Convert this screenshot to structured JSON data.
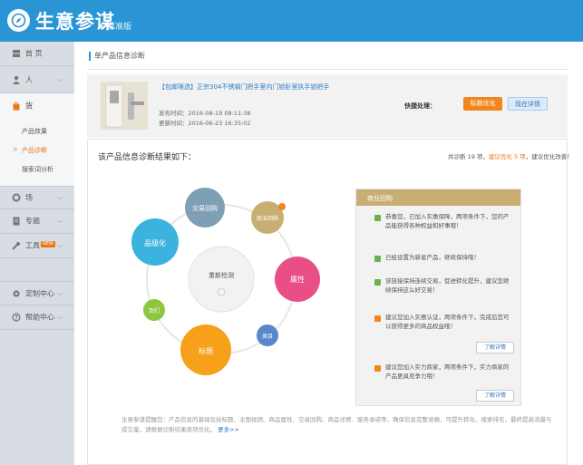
{
  "header": {
    "brand": "生意参谋",
    "edition": "标准版"
  },
  "sidebar": {
    "items": [
      {
        "label": "首 页",
        "icon": "home-icon",
        "chevron": ""
      },
      {
        "label": "人",
        "icon": "user-icon",
        "chevron": "⌵"
      },
      {
        "label": "货",
        "icon": "bag-icon",
        "chevron": ""
      },
      {
        "label": "场",
        "icon": "gear-icon",
        "chevron": "⌵"
      },
      {
        "label": "专题",
        "icon": "file-icon",
        "chevron": "⌵"
      },
      {
        "label": "工具",
        "icon": "wrench-icon",
        "chevron": "⌵",
        "badge": "NEW"
      },
      {
        "label": "定制中心",
        "icon": "settings-icon",
        "chevron": "⌵"
      },
      {
        "label": "帮助中心",
        "icon": "help-icon",
        "chevron": "⌵"
      }
    ],
    "sub_items": [
      "产品效果",
      "产品诊断",
      "搜索词分析"
    ]
  },
  "breadcrumb": "单产品信息诊断",
  "product": {
    "title": "【包邮限选】正宗304不锈钢门把手室内门锁卧室执手锁把手",
    "publish_label": "发布时间：",
    "publish_time": "2016-08-19 08:11:38",
    "update_label": "更新时间：",
    "update_time": "2016-06-23 16:35:02",
    "optimize_label": "快捷处理：",
    "btn_optimize": "标题优化",
    "btn_detail": "现在详情"
  },
  "result": {
    "title": "该产品信息诊断结果如下：",
    "summary_pre": "共诊断 19 项，",
    "summary_highlight": "建议优化 5 项",
    "summary_post": "，建议优化改善！"
  },
  "diagram": {
    "center": "重新检测",
    "bubbles": [
      "交易回购",
      "商业回购",
      "品级化",
      "属性",
      "到们",
      "标题",
      "类目"
    ]
  },
  "business": {
    "title": "商业回购",
    "items": [
      {
        "status": "ok",
        "text": "恭喜您，已加入实惠保障，两项条件下，您的产品能获得各种权益和好事哦！"
      },
      {
        "status": "ok",
        "text": "已经设置为新星产品，继续保持哦！"
      },
      {
        "status": "ok",
        "text": "该链接保持连续交易，促进转化提升，建议您继续保持这么好交易！"
      },
      {
        "status": "warn",
        "text": "建议您加入实惠认证，两项条件下，完成后您可以获得更多的商品权益哦！",
        "button": "了解详情"
      },
      {
        "status": "warn",
        "text": "建议您加入实力商家，两项条件下，实力商家的产品更具竞争力哦！",
        "button": "了解详情"
      }
    ]
  },
  "tips": {
    "text": "生意参谋提醒您：产品信息的基础包括标题、主图视频、商品属性、交易回购、商品详情、服务承诺等，确保信息完整准确，可提升转化、搜索排名，最终提高流量与成交量，请根据诊断结果逐项优化。",
    "more": "更多>>"
  },
  "colors": {
    "brand": "#2a95d5",
    "accent": "#f0861c",
    "gold": "#c9ae73"
  }
}
